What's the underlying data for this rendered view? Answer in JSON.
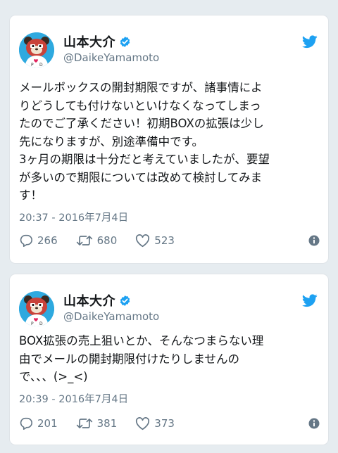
{
  "tweets": [
    {
      "display_name": "山本大介",
      "handle": "@DaikeYamamoto",
      "text": "メールボックスの開封期限ですが、諸事情によ\nりどうしても付けないといけなくなってしまっ\nたのでご了承ください！初期BOXの拡張は少し\n先になりますが、別途準備中です。\n3ヶ月の期限は十分だと考えていましたが、要望\nが多いので期限については改めて検討してみま\nす！",
      "timestamp": "20:37 - 2016年7月4日",
      "replies": "266",
      "retweets": "680",
      "likes": "523"
    },
    {
      "display_name": "山本大介",
      "handle": "@DaikeYamamoto",
      "text": "BOX拡張の売上狙いとか、そんなつまらない理\n由でメールの開封期限付けたりしませんの\nで、、、(>_<)",
      "timestamp": "20:39 - 2016年7月4日",
      "replies": "201",
      "retweets": "381",
      "likes": "373"
    }
  ],
  "icons": {
    "brand": "twitter-bird-icon",
    "verified": "verified-badge-icon",
    "reply": "reply-icon",
    "retweet": "retweet-icon",
    "like": "heart-icon",
    "info": "info-icon"
  },
  "colors": {
    "background": "#e6ecf0",
    "twitter_blue": "#1da1f2",
    "muted_text": "#657786",
    "avatar_bg": "#2ea9df"
  }
}
